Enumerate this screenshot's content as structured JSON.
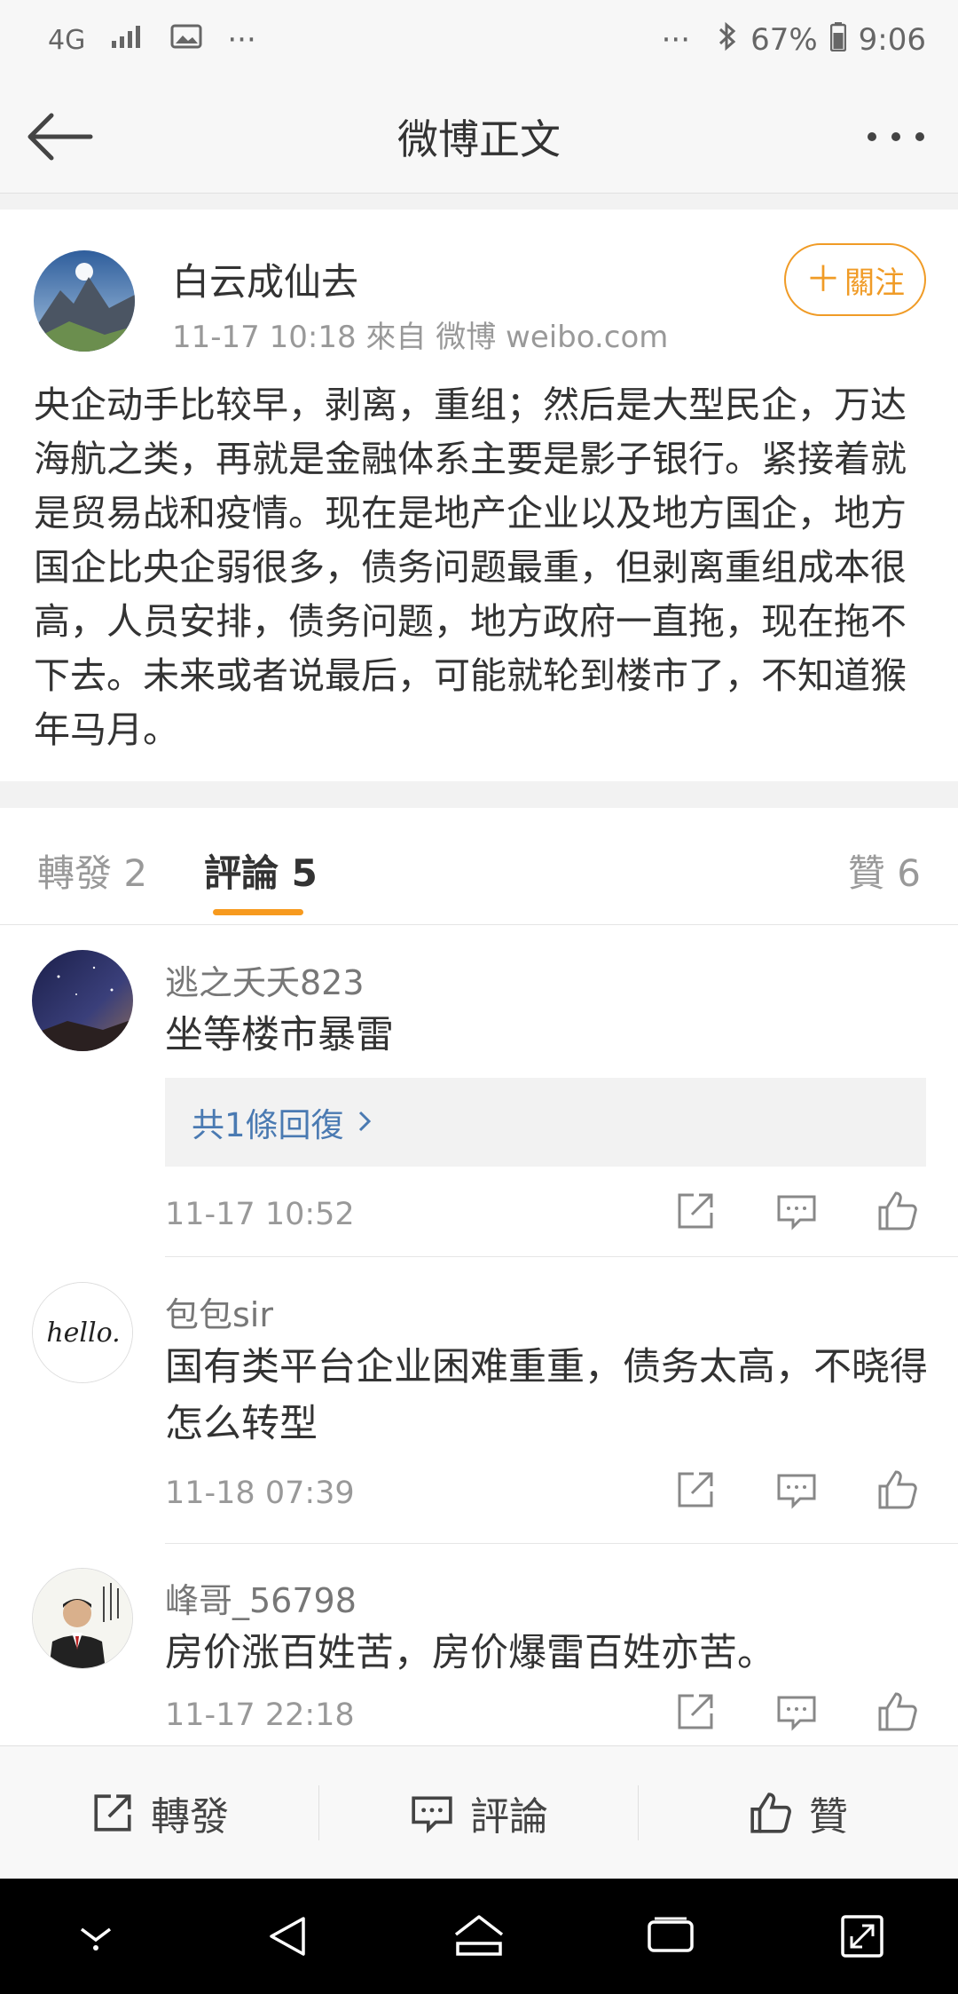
{
  "status_bar": {
    "network": "4G",
    "more_left": "···",
    "more_right": "···",
    "battery": "67%",
    "time": "9:06"
  },
  "nav": {
    "title": "微博正文"
  },
  "post": {
    "author": "白云成仙去",
    "meta": "11-17 10:18  來自 微博 weibo.com",
    "follow_label": "關注",
    "text": "央企动手比较早，剥离，重组；然后是大型民企，万达海航之类，再就是金融体系主要是影子银行。紧接着就是贸易战和疫情。现在是地产企业以及地方国企，地方国企比央企弱很多，债务问题最重，但剥离重组成本很高，人员安排，债务问题，地方政府一直拖，现在拖不下去。未来或者说最后，可能就轮到楼市了，不知道猴年马月。"
  },
  "tabs": {
    "repost": "轉發 2",
    "comments": "評論 5",
    "likes": "贊 6",
    "active": "comments"
  },
  "comments": [
    {
      "name": "逃之夭夭823",
      "text": "坐等楼市暴雷",
      "replies": "共1條回復",
      "time": "11-17 10:52"
    },
    {
      "name": "包包sir",
      "avatar_text": "hello.",
      "text": "国有类平台企业困难重重，债务太高，不晓得怎么转型",
      "time": "11-18 07:39"
    },
    {
      "name": "峰哥_56798",
      "text": "房价涨百姓苦，房价爆雷百姓亦苦。",
      "time": "11-17 22:18"
    }
  ],
  "bottom_bar": {
    "repost": "轉發",
    "comment": "評論",
    "like": "贊"
  },
  "colors": {
    "accent": "#f09b26",
    "link": "#4a7ab2"
  }
}
